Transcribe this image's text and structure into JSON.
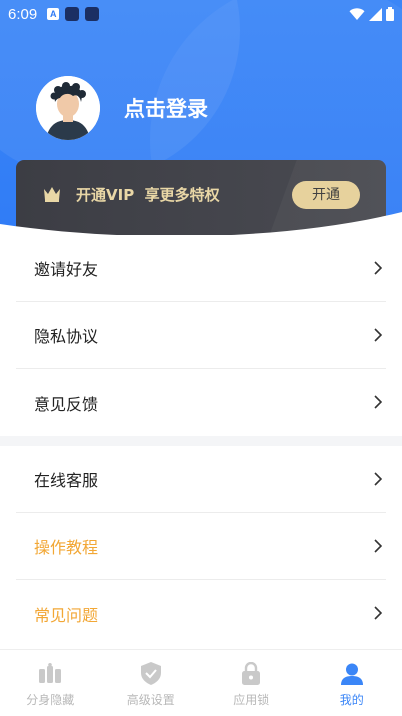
{
  "status_bar": {
    "time": "6:09"
  },
  "profile": {
    "login_label": "点击登录"
  },
  "vip": {
    "text": "开通VIP  享更多特权",
    "button": "开通"
  },
  "menu_group_1": [
    {
      "label": "邀请好友",
      "highlight": false
    },
    {
      "label": "隐私协议",
      "highlight": false
    },
    {
      "label": "意见反馈",
      "highlight": false
    }
  ],
  "menu_group_2": [
    {
      "label": "在线客服",
      "highlight": false
    },
    {
      "label": "操作教程",
      "highlight": true
    },
    {
      "label": "常见问题",
      "highlight": true
    }
  ],
  "tabs": [
    {
      "label": "分身隐藏",
      "icon": "apps-hide-icon",
      "active": false
    },
    {
      "label": "高级设置",
      "icon": "shield-check-icon",
      "active": false
    },
    {
      "label": "应用锁",
      "icon": "lock-icon",
      "active": false
    },
    {
      "label": "我的",
      "icon": "person-icon",
      "active": true
    }
  ],
  "colors": {
    "primary": "#3b86f7",
    "vip_gold": "#e6d19a",
    "highlight_text": "#f2a735"
  }
}
